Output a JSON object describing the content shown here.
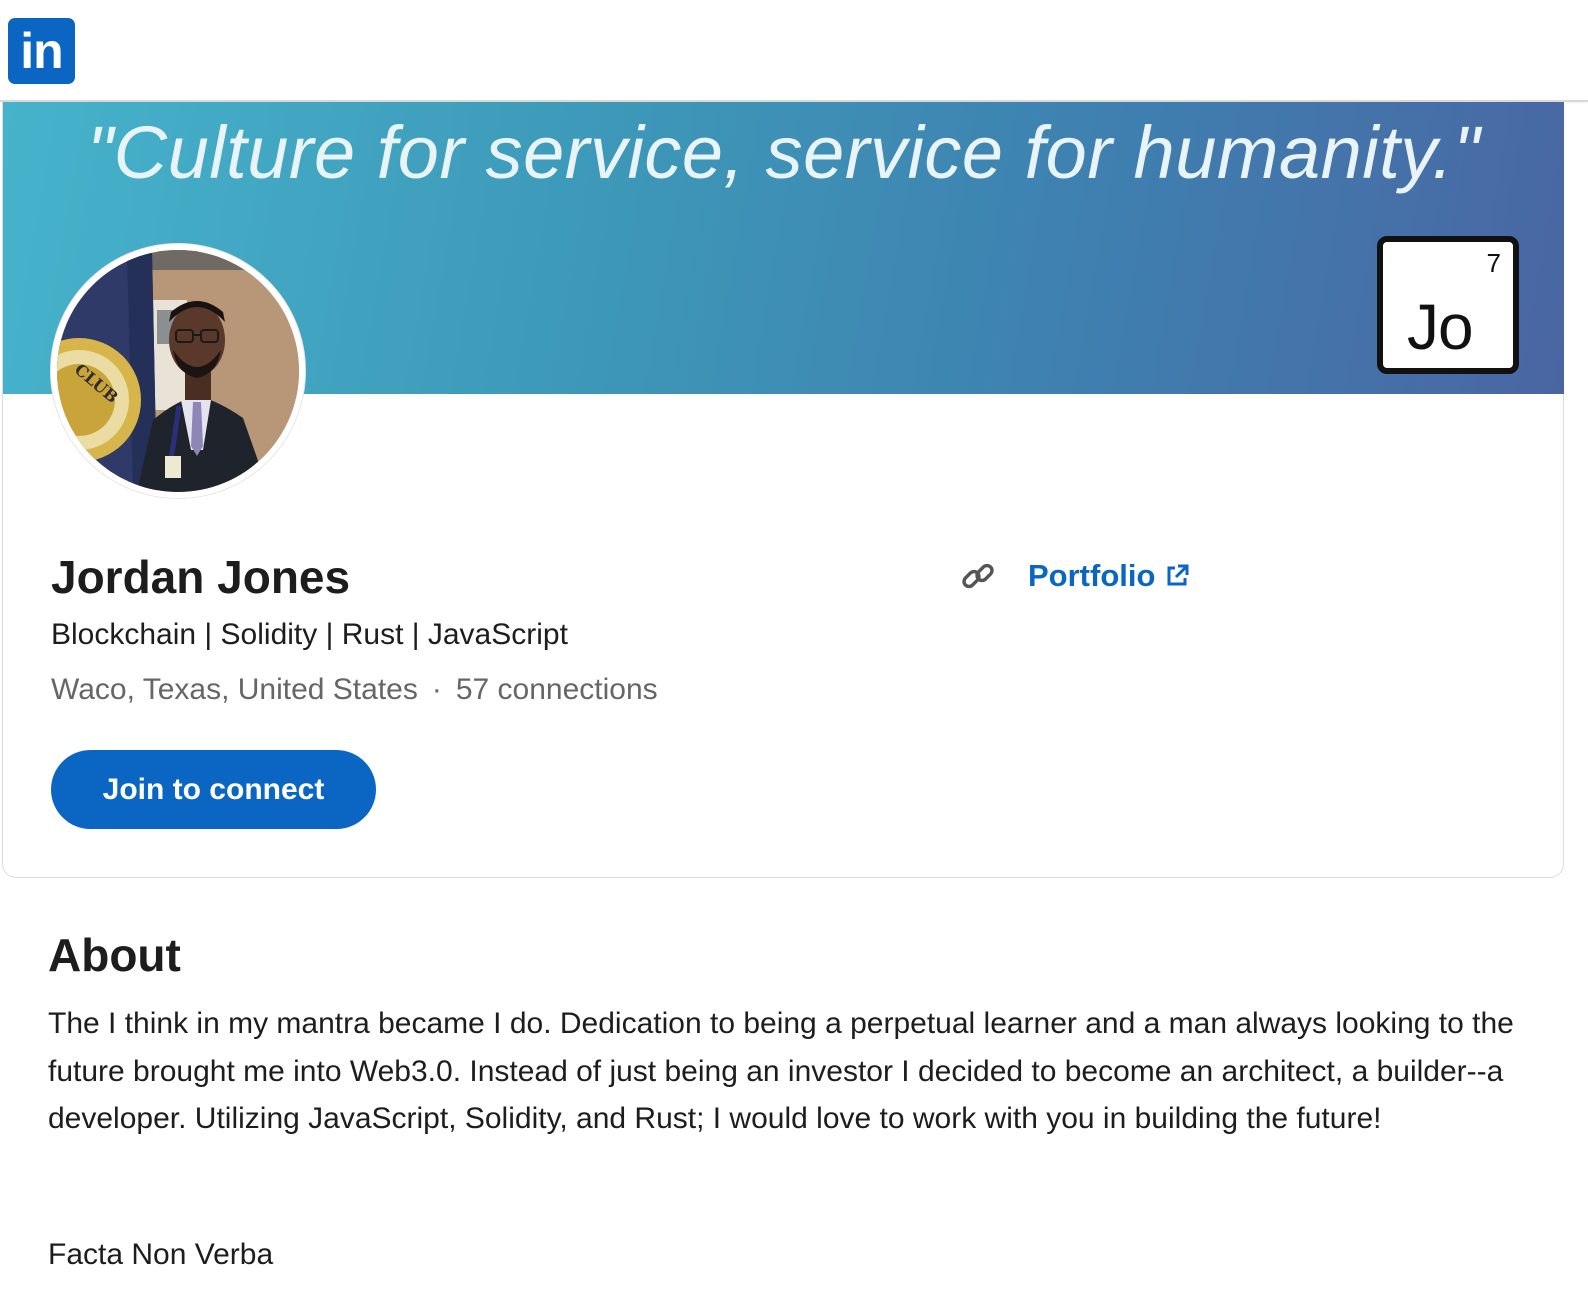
{
  "header": {
    "logo_text": "in",
    "logo_color": "#0a66c2"
  },
  "banner": {
    "quote": "\"Culture for service, service for humanity.\"",
    "element_tile": {
      "number": "7",
      "symbol": "Jo"
    }
  },
  "profile": {
    "name": "Jordan Jones",
    "headline": "Blockchain | Solidity | Rust | JavaScript",
    "location": "Waco, Texas, United States",
    "separator": "·",
    "connections": "57 connections",
    "connect_button": "Join to connect",
    "website_label": "Portfolio",
    "accent_color": "#0a66c2"
  },
  "about": {
    "title": "About",
    "body": "The I think in my mantra became I do. Dedication to being a perpetual learner and a man always looking to the future brought me into Web3.0. Instead of just being an investor I decided to become an architect, a builder--a developer. Utilizing JavaScript, Solidity, and Rust; I would love to work with you in building the future!",
    "motto": "Facta Non Verba"
  }
}
